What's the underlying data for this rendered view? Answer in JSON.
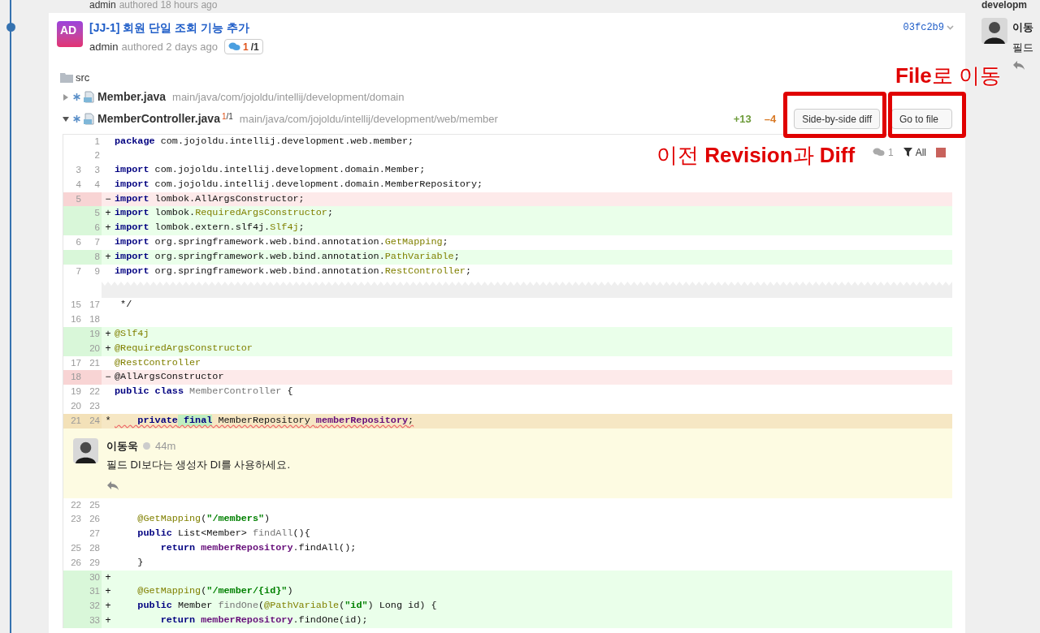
{
  "previous_commit": {
    "author": "admin",
    "meta": "authored 18 hours ago"
  },
  "commit": {
    "avatar": "AD",
    "title": "[JJ-1] 회원 단일 조회 기능 추가",
    "author": "admin",
    "meta": "authored 2 days ago",
    "comments_count": "1",
    "comments_total": "/1",
    "hash": "03fc2b9"
  },
  "tree": {
    "folder": "src",
    "files": [
      {
        "name": "Member.java",
        "path": "main/java/com/jojoldu/intellij/development/domain",
        "expanded": false
      },
      {
        "name": "MemberController.java",
        "comments_count": "1",
        "comments_total": "/1",
        "path": "main/java/com/jojoldu/intellij/development/web/member",
        "expanded": true
      }
    ]
  },
  "diff_stats": {
    "added": "+13",
    "removed": "–4"
  },
  "buttons": [
    "Side-by-side diff",
    "Go to file"
  ],
  "diff_toolbar": {
    "comments": "1",
    "filter": "All"
  },
  "annotations": [
    "**File**로 이동",
    "이전 **Revision**과 **Diff**"
  ],
  "lines": [
    {
      "kind": "line",
      "added": false,
      "removed": false,
      "highlighted": false,
      "new": "1",
      "tokens": [
        {
          "kind": "keyword",
          "text": "package"
        },
        {
          "kind": "plain",
          "text": " com.jojoldu.intellij.development.web.member;"
        }
      ]
    },
    {
      "kind": "line",
      "added": false,
      "removed": false,
      "highlighted": false,
      "new": "2"
    },
    {
      "kind": "line",
      "added": false,
      "removed": false,
      "highlighted": false,
      "old": "3",
      "new": "3",
      "tokens": [
        {
          "kind": "keyword",
          "text": "import"
        },
        {
          "kind": "plain",
          "text": " com.jojoldu.intellij.development.domain.Member;"
        }
      ]
    },
    {
      "kind": "line",
      "added": false,
      "removed": false,
      "highlighted": false,
      "old": "4",
      "new": "4",
      "tokens": [
        {
          "kind": "keyword",
          "text": "import"
        },
        {
          "kind": "plain",
          "text": " com.jojoldu.intellij.development.domain.MemberRepository;"
        }
      ]
    },
    {
      "kind": "line",
      "added": false,
      "removed": true,
      "highlighted": false,
      "old": "5",
      "marker": "−",
      "tokens": [
        {
          "kind": "keyword",
          "text": "import"
        },
        {
          "kind": "plain",
          "text": " lombok.AllArgsConstructor;"
        }
      ]
    },
    {
      "kind": "line",
      "added": true,
      "removed": false,
      "highlighted": false,
      "new": "5",
      "marker": "+",
      "tokens": [
        {
          "kind": "keyword",
          "text": "import"
        },
        {
          "kind": "plain",
          "text": " lombok."
        },
        {
          "kind": "annotation",
          "text": "RequiredArgsConstructor"
        },
        {
          "kind": "plain",
          "text": ";"
        }
      ]
    },
    {
      "kind": "line",
      "added": true,
      "removed": false,
      "highlighted": false,
      "new": "6",
      "marker": "+",
      "tokens": [
        {
          "kind": "keyword",
          "text": "import"
        },
        {
          "kind": "plain",
          "text": " lombok.extern.slf4j."
        },
        {
          "kind": "annotation",
          "text": "Slf4j"
        },
        {
          "kind": "plain",
          "text": ";"
        }
      ]
    },
    {
      "kind": "line",
      "added": false,
      "removed": false,
      "highlighted": false,
      "old": "6",
      "new": "7",
      "tokens": [
        {
          "kind": "keyword",
          "text": "import"
        },
        {
          "kind": "plain",
          "text": " org.springframework.web.bind.annotation."
        },
        {
          "kind": "annotation",
          "text": "GetMapping"
        },
        {
          "kind": "plain",
          "text": ";"
        }
      ]
    },
    {
      "kind": "line",
      "added": true,
      "removed": false,
      "highlighted": false,
      "new": "8",
      "marker": "+",
      "tokens": [
        {
          "kind": "keyword",
          "text": "import"
        },
        {
          "kind": "plain",
          "text": " org.springframework.web.bind.annotation."
        },
        {
          "kind": "annotation",
          "text": "PathVariable"
        },
        {
          "kind": "plain",
          "text": ";"
        }
      ]
    },
    {
      "kind": "line",
      "added": false,
      "removed": false,
      "highlighted": false,
      "old": "7",
      "new": "9",
      "tokens": [
        {
          "kind": "keyword",
          "text": "import"
        },
        {
          "kind": "plain",
          "text": " org.springframework.web.bind.annotation."
        },
        {
          "kind": "annotation",
          "text": "RestController"
        },
        {
          "kind": "plain",
          "text": ";"
        }
      ]
    },
    {
      "kind": "fold"
    },
    {
      "kind": "line",
      "added": false,
      "removed": false,
      "highlighted": false,
      "old": "15",
      "new": "17",
      "tokens": [
        {
          "kind": "plain",
          "text": " */"
        }
      ]
    },
    {
      "kind": "line",
      "added": false,
      "removed": false,
      "highlighted": false,
      "old": "16",
      "new": "18"
    },
    {
      "kind": "line",
      "added": true,
      "removed": false,
      "highlighted": false,
      "new": "19",
      "marker": "+",
      "tokens": [
        {
          "kind": "annotation",
          "text": "@Slf4j"
        }
      ]
    },
    {
      "kind": "line",
      "added": true,
      "removed": false,
      "highlighted": false,
      "new": "20",
      "marker": "+",
      "tokens": [
        {
          "kind": "annotation",
          "text": "@RequiredArgsConstructor"
        }
      ]
    },
    {
      "kind": "line",
      "added": false,
      "removed": false,
      "highlighted": false,
      "old": "17",
      "new": "21",
      "tokens": [
        {
          "kind": "annotation",
          "text": "@RestController"
        }
      ]
    },
    {
      "kind": "line",
      "added": false,
      "removed": true,
      "highlighted": false,
      "old": "18",
      "marker": "−",
      "tokens": [
        {
          "kind": "plain",
          "text": "@AllArgsConstructor"
        }
      ]
    },
    {
      "kind": "line",
      "added": false,
      "removed": false,
      "highlighted": false,
      "old": "19",
      "new": "22",
      "tokens": [
        {
          "kind": "keyword",
          "text": "public"
        },
        {
          "kind": "keyword",
          "text": " class"
        },
        {
          "kind": "declaration",
          "text": " MemberController"
        },
        {
          "kind": "plain",
          "text": " {"
        }
      ]
    },
    {
      "kind": "line",
      "added": false,
      "removed": false,
      "highlighted": false,
      "old": "20",
      "new": "23"
    },
    {
      "kind": "line",
      "added": false,
      "removed": false,
      "highlighted": true,
      "old": "21",
      "new": "24",
      "marker": "*",
      "warning": true,
      "tokens": [
        {
          "kind": "keyword",
          "text": "    private"
        },
        {
          "kind": "inserted-keyword",
          "text": " final"
        },
        {
          "kind": "plain",
          "text": " MemberRepository "
        },
        {
          "kind": "field",
          "text": "memberRepository"
        },
        {
          "kind": "plain",
          "text": ";"
        }
      ]
    },
    {
      "kind": "comment",
      "author": "이동욱",
      "time": "44m",
      "text": "필드 DI보다는 생성자 DI를 사용하세요."
    },
    {
      "kind": "line",
      "added": false,
      "removed": false,
      "highlighted": false,
      "old": "22",
      "new": "25"
    },
    {
      "kind": "line",
      "added": false,
      "removed": false,
      "highlighted": false,
      "old": "23",
      "new": "26",
      "tokens": [
        {
          "kind": "annotation",
          "text": "    @GetMapping"
        },
        {
          "kind": "plain",
          "text": "("
        },
        {
          "kind": "string",
          "text": "\"/members\""
        },
        {
          "kind": "plain",
          "text": ")"
        }
      ]
    },
    {
      "kind": "line",
      "added": false,
      "removed": false,
      "highlighted": false,
      "new": "27",
      "tokens": [
        {
          "kind": "keyword",
          "text": "    public"
        },
        {
          "kind": "plain",
          "text": " List<Member> "
        },
        {
          "kind": "declaration",
          "text": "findAll"
        },
        {
          "kind": "plain",
          "text": "(){"
        }
      ]
    },
    {
      "kind": "line",
      "added": false,
      "removed": false,
      "highlighted": false,
      "old": "25",
      "new": "28",
      "tokens": [
        {
          "kind": "keyword",
          "text": "        return"
        },
        {
          "kind": "field",
          "text": " memberRepository"
        },
        {
          "kind": "plain",
          "text": ".findAll();"
        }
      ]
    },
    {
      "kind": "line",
      "added": false,
      "removed": false,
      "highlighted": false,
      "old": "26",
      "new": "29",
      "tokens": [
        {
          "kind": "plain",
          "text": "    }"
        }
      ]
    },
    {
      "kind": "line",
      "added": true,
      "removed": false,
      "highlighted": false,
      "new": "30",
      "marker": "+"
    },
    {
      "kind": "line",
      "added": true,
      "removed": false,
      "highlighted": false,
      "new": "31",
      "marker": "+",
      "tokens": [
        {
          "kind": "annotation",
          "text": "    @GetMapping"
        },
        {
          "kind": "plain",
          "text": "("
        },
        {
          "kind": "string",
          "text": "\"/member/{id}\""
        },
        {
          "kind": "plain",
          "text": ")"
        }
      ]
    },
    {
      "kind": "line",
      "added": true,
      "removed": false,
      "highlighted": false,
      "new": "32",
      "marker": "+",
      "tokens": [
        {
          "kind": "keyword",
          "text": "    public"
        },
        {
          "kind": "plain",
          "text": " Member "
        },
        {
          "kind": "declaration",
          "text": "findOne"
        },
        {
          "kind": "plain",
          "text": "("
        },
        {
          "kind": "annotation",
          "text": "@PathVariable"
        },
        {
          "kind": "plain",
          "text": "("
        },
        {
          "kind": "string",
          "text": "\"id\""
        },
        {
          "kind": "plain",
          "text": ") Long id) {"
        }
      ]
    },
    {
      "kind": "line",
      "added": true,
      "removed": false,
      "highlighted": false,
      "new": "33",
      "marker": "+",
      "tokens": [
        {
          "kind": "keyword",
          "text": "        return"
        },
        {
          "kind": "field",
          "text": " memberRepository"
        },
        {
          "kind": "plain",
          "text": ".findOne(id);"
        }
      ]
    }
  ],
  "side_panel": {
    "heading": "developm",
    "author": "이동",
    "text": "필드"
  }
}
